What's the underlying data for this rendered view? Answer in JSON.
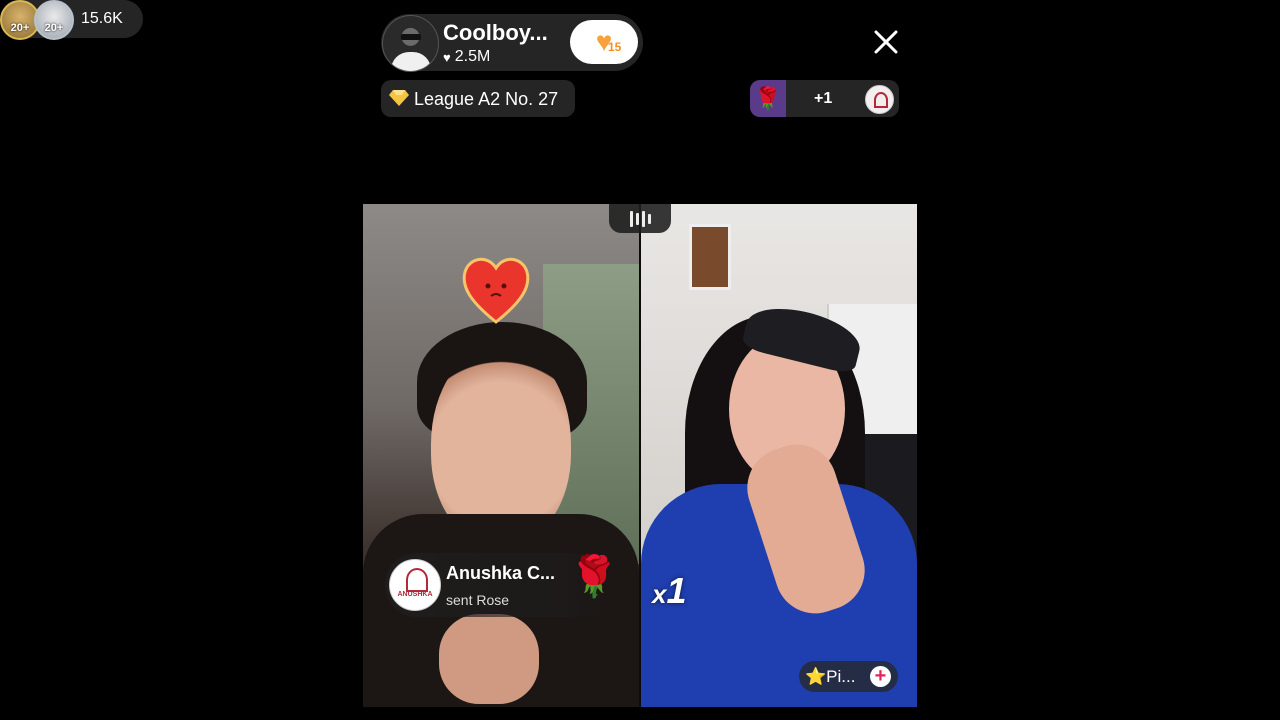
{
  "host": {
    "name": "Coolboy...",
    "likes": "2.5M",
    "fan_level": "15"
  },
  "viewers": {
    "avatar_1_badge": "20+",
    "avatar_2_badge": "20+",
    "count": "15.6K"
  },
  "league": {
    "label": "League A2 No. 27"
  },
  "top_gift": {
    "emoji": "🌹",
    "count": "+1"
  },
  "gift_toast": {
    "sender": "Anushka C...",
    "action": "sent Rose",
    "gift_emoji": "🌹",
    "avatar_text": "ANUSHKA"
  },
  "combo": {
    "prefix": "x",
    "count": "1"
  },
  "guest": {
    "name": "⭐Pi...",
    "add_symbol": "+"
  },
  "colors": {
    "accent_gold": "#f7a23a",
    "gift_purple": "#5a3b8a",
    "add_pink": "#e0245e"
  },
  "icons": [
    "heart-icon",
    "diamond-icon",
    "close-icon",
    "audio-bars-icon",
    "rose-icon"
  ]
}
